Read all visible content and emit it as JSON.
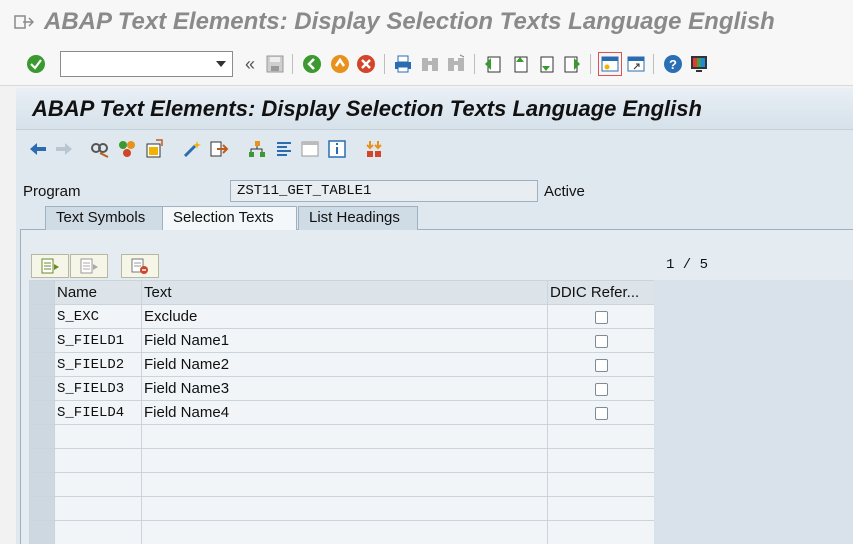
{
  "window": {
    "title": "ABAP Text Elements: Display Selection Texts Language English"
  },
  "system_toolbar": {
    "command_field_value": "",
    "icons": [
      "enter-icon",
      "command-field",
      "back-arrows-icon",
      "save-icon",
      "back-icon",
      "exit-icon",
      "cancel-icon",
      "print-icon",
      "find-icon",
      "find-next-icon",
      "first-page-icon",
      "previous-page-icon",
      "next-page-icon",
      "last-page-icon",
      "create-session-icon",
      "generate-shortcut-icon",
      "help-icon",
      "customize-layout-icon"
    ]
  },
  "app": {
    "title": "ABAP Text Elements: Display Selection Texts Language English"
  },
  "header": {
    "program_label": "Program",
    "program_value": "ZST11_GET_TABLE1",
    "status": "Active"
  },
  "tabs": [
    {
      "label": "Text Symbols",
      "active": false
    },
    {
      "label": "Selection Texts",
      "active": true
    },
    {
      "label": "List Headings",
      "active": false
    }
  ],
  "table": {
    "counter": "1 / 5",
    "columns": [
      "Name",
      "Text",
      "DDIC Refer..."
    ],
    "rows": [
      {
        "name": "S_EXC",
        "text": "Exclude",
        "ddic": false
      },
      {
        "name": "S_FIELD1",
        "text": "Field Name1",
        "ddic": false
      },
      {
        "name": "S_FIELD2",
        "text": "Field Name2",
        "ddic": false
      },
      {
        "name": "S_FIELD3",
        "text": "Field Name3",
        "ddic": false
      },
      {
        "name": "S_FIELD4",
        "text": "Field Name4",
        "ddic": false
      }
    ],
    "empty_rows": 5
  },
  "colors": {
    "app_background": "#dfe8ef",
    "title_bar": "#f7f7f7",
    "accent_green": "#3a9a2f",
    "accent_orange": "#e8911c",
    "accent_red": "#d2452b",
    "help_blue": "#2a6fb5"
  }
}
